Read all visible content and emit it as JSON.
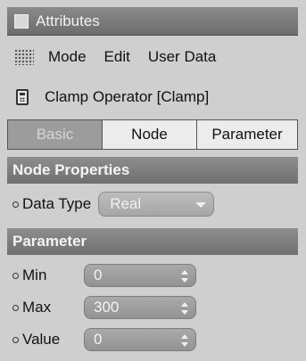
{
  "window": {
    "title": "Attributes"
  },
  "menu": {
    "items": [
      "Mode",
      "Edit",
      "User Data"
    ]
  },
  "object": {
    "title": "Clamp Operator [Clamp]"
  },
  "tabs": [
    "Basic",
    "Node",
    "Parameter"
  ],
  "node_properties": {
    "header": "Node Properties",
    "data_type_label": "Data Type",
    "data_type_value": "Real"
  },
  "parameter": {
    "header": "Parameter",
    "fields": [
      {
        "label": "Min",
        "value": "0"
      },
      {
        "label": "Max",
        "value": "300"
      },
      {
        "label": "Value",
        "value": "0"
      }
    ]
  }
}
